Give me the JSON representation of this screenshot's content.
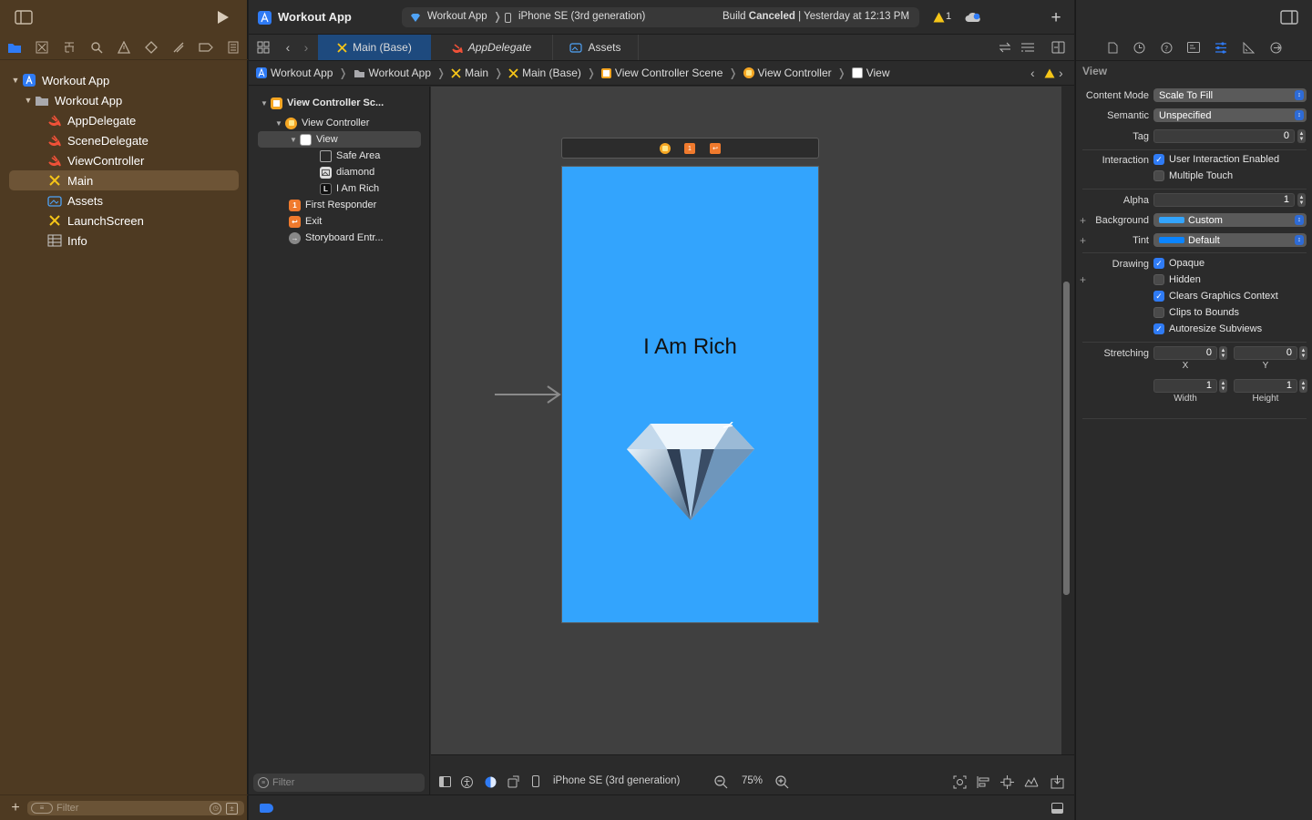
{
  "toolbar": {
    "project_title": "Workout App",
    "scheme": "Workout App",
    "destination": "iPhone SE (3rd generation)",
    "build_status_prefix": "Build",
    "build_status_bold": "Canceled",
    "build_status_time": "| Yesterday at 12:13 PM",
    "warning_count": "1"
  },
  "navigator": {
    "items": [
      {
        "label": "Workout App",
        "icon": "app-project-icon"
      },
      {
        "label": "Workout App",
        "icon": "folder-icon"
      },
      {
        "label": "AppDelegate",
        "icon": "swift-icon"
      },
      {
        "label": "SceneDelegate",
        "icon": "swift-icon"
      },
      {
        "label": "ViewController",
        "icon": "swift-icon"
      },
      {
        "label": "Main",
        "icon": "storyboard-icon"
      },
      {
        "label": "Assets",
        "icon": "asset-catalog-icon"
      },
      {
        "label": "LaunchScreen",
        "icon": "storyboard-icon"
      },
      {
        "label": "Info",
        "icon": "plist-table-icon"
      }
    ],
    "selected": "Main",
    "filter_placeholder": "Filter"
  },
  "tabs": [
    {
      "label": "Main (Base)",
      "icon": "storyboard-icon",
      "active": true
    },
    {
      "label": "AppDelegate",
      "icon": "swift-icon",
      "active": false
    },
    {
      "label": "Assets",
      "icon": "asset-catalog-icon",
      "active": false
    }
  ],
  "jumpbar": [
    "Workout App",
    "Workout App",
    "Main",
    "Main (Base)",
    "View Controller Scene",
    "View Controller",
    "View"
  ],
  "outline": {
    "items": [
      {
        "label": "View Controller Sc..."
      },
      {
        "label": "View Controller"
      },
      {
        "label": "View"
      },
      {
        "label": "Safe Area"
      },
      {
        "label": "diamond"
      },
      {
        "label": "I Am Rich"
      },
      {
        "label": "First Responder"
      },
      {
        "label": "Exit"
      },
      {
        "label": "Storyboard Entr..."
      }
    ],
    "filter_placeholder": "Filter"
  },
  "canvas": {
    "label_text": "I Am Rich",
    "background_color": "#33a4fd"
  },
  "canvas_bottom": {
    "device": "iPhone SE (3rd generation)",
    "zoom": "75%"
  },
  "inspector": {
    "section_title": "View",
    "content_mode_label": "Content Mode",
    "content_mode": "Scale To Fill",
    "semantic_label": "Semantic",
    "semantic": "Unspecified",
    "tag_label": "Tag",
    "tag": "0",
    "interaction_label": "Interaction",
    "user_interaction": "User Interaction Enabled",
    "multiple_touch": "Multiple Touch",
    "alpha_label": "Alpha",
    "alpha": "1",
    "background_label": "Background",
    "background": "Custom",
    "tint_label": "Tint",
    "tint": "Default",
    "drawing_label": "Drawing",
    "opaque": "Opaque",
    "hidden": "Hidden",
    "clears_context": "Clears Graphics Context",
    "clips_bounds": "Clips to Bounds",
    "autoresize": "Autoresize Subviews",
    "stretching_label": "Stretching",
    "stretch_x": "0",
    "stretch_y": "0",
    "stretch_w": "1",
    "stretch_h": "1",
    "x_label": "X",
    "y_label": "Y",
    "w_label": "Width",
    "h_label": "Height"
  }
}
